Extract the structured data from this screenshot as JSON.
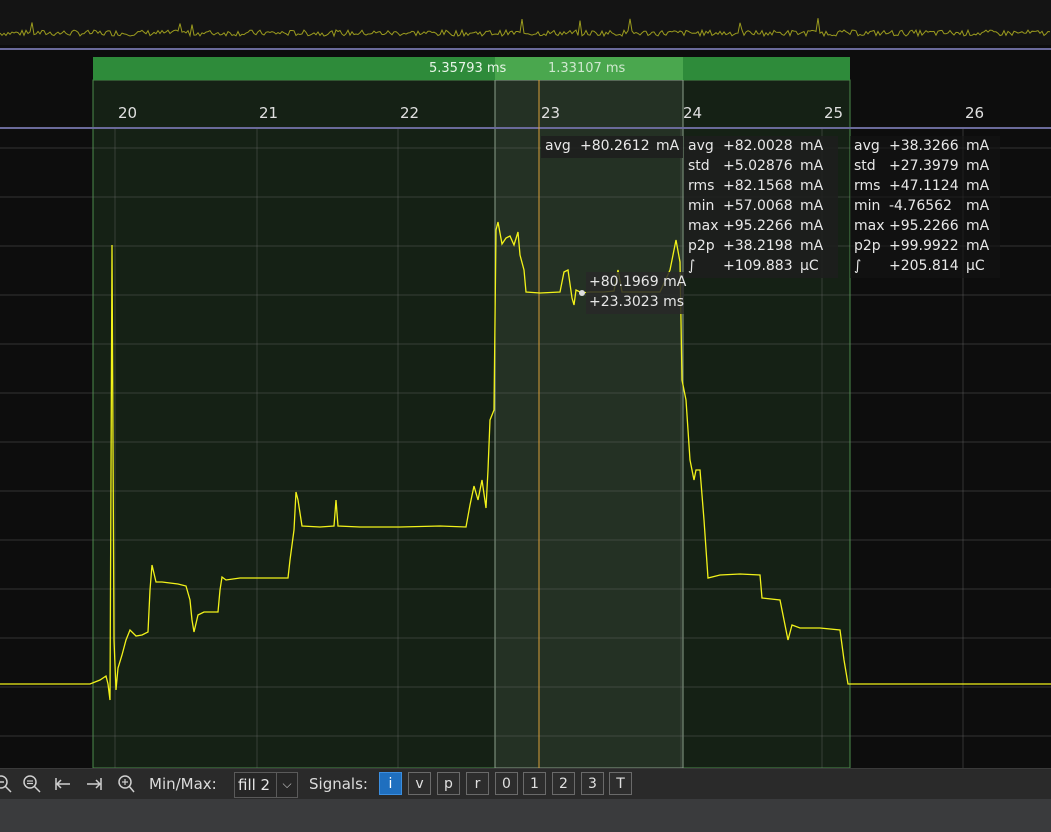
{
  "toolbar": {
    "minmax_label": "Min/Max:",
    "minmax_value": "fill 2",
    "signals_label": "Signals:",
    "signals": [
      {
        "label": "i",
        "active": true
      },
      {
        "label": "v",
        "active": false
      },
      {
        "label": "p",
        "active": false
      },
      {
        "label": "r",
        "active": false
      },
      {
        "label": "0",
        "active": false
      },
      {
        "label": "1",
        "active": false
      },
      {
        "label": "2",
        "active": false
      },
      {
        "label": "3",
        "active": false
      },
      {
        "label": "T",
        "active": false
      }
    ],
    "icons": [
      "zoom-out-icon",
      "zoom-fit-icon",
      "jump-start-icon",
      "jump-end-icon",
      "zoom-reset-icon"
    ]
  },
  "spans": {
    "outer_duration": "5.35793 ms",
    "inner_duration": "1.33107 ms"
  },
  "x_axis": {
    "ticks": [
      "20",
      "21",
      "22",
      "23",
      "24",
      "25",
      "26"
    ]
  },
  "inner_stats": {
    "avg": {
      "key": "avg",
      "value": "+80.2612",
      "unit": "mA"
    }
  },
  "outer_stats": {
    "rows": [
      {
        "key": "avg",
        "value": "+82.0028",
        "unit": "mA"
      },
      {
        "key": "std",
        "value": "+5.02876",
        "unit": "mA"
      },
      {
        "key": "rms",
        "value": "+82.1568",
        "unit": "mA"
      },
      {
        "key": "min",
        "value": "+57.0068",
        "unit": "mA"
      },
      {
        "key": "max",
        "value": "+95.2266",
        "unit": "mA"
      },
      {
        "key": "p2p",
        "value": "+38.2198",
        "unit": "mA"
      },
      {
        "key": "∫",
        "value": "+109.883",
        "unit": "µC"
      }
    ]
  },
  "right_stats": {
    "rows": [
      {
        "key": "avg",
        "value": "+38.3266",
        "unit": "mA"
      },
      {
        "key": "std",
        "value": "+27.3979",
        "unit": "mA"
      },
      {
        "key": "rms",
        "value": "+47.1124",
        "unit": "mA"
      },
      {
        "key": "min",
        "value": "-4.76562",
        "unit": "mA"
      },
      {
        "key": "max",
        "value": "+95.2266",
        "unit": "mA"
      },
      {
        "key": "p2p",
        "value": "+99.9922",
        "unit": "mA"
      },
      {
        "key": "∫",
        "value": "+205.814",
        "unit": "µC"
      }
    ]
  },
  "cursor": {
    "current": "+80.1969 mA",
    "time": "+23.3023 ms"
  },
  "colors": {
    "trace": "#f2f21a",
    "span_bar": "#2e8b3a",
    "span_fill": "rgba(60,150,60,0.13)",
    "inner_fill": "rgba(180,200,180,0.10)",
    "active_signal": "#1f6fbf"
  }
}
